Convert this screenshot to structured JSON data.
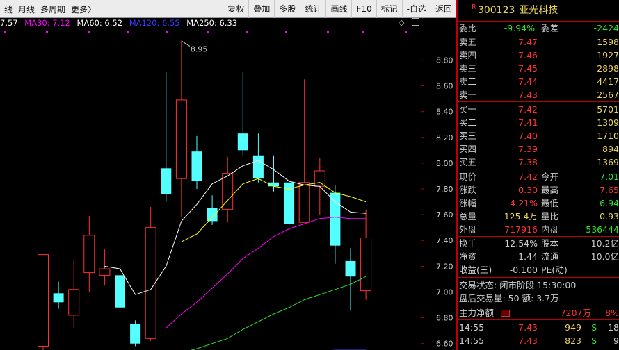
{
  "toolbar": {
    "left_items": [
      "线",
      "月线",
      "多周期",
      "更多〉"
    ],
    "right_buttons": [
      "复权",
      "叠加",
      "多股",
      "统计",
      "画线",
      "F10",
      "标记",
      "-自选",
      "返回"
    ]
  },
  "ma": {
    "ma_first": "7.57",
    "ma30": "MA30: 7.12",
    "ma60": "MA60: 6.52",
    "ma120": "MA120: 6.55",
    "ma250": "MA250: 6.33",
    "color_first": "#ffffff",
    "color_ma30": "#ff00ff",
    "color_ma60": "#2ee32e",
    "color_ma120": "#3a3aff",
    "color_ma250": "#ffffff"
  },
  "chart_data": {
    "type": "candlestick",
    "y_ticks": [
      "8.80",
      "8.60",
      "8.40",
      "8.20",
      "8.00",
      "7.80",
      "7.60",
      "7.40",
      "7.20",
      "7.00",
      "6.80",
      "6.60"
    ],
    "y_range": [
      6.55,
      9.05
    ],
    "peak_label": "8.95",
    "colors": {
      "up": "#ff3232",
      "down": "#54ffff",
      "ma_white": "#ffffff",
      "ma_yellow": "#ffff00",
      "ma_magenta": "#ff00ff",
      "ma_green": "#2ee32e",
      "ma_blue": "#3a3aff"
    },
    "candles": [
      {
        "o": 6.58,
        "h": 7.29,
        "l": 6.55,
        "c": 7.29
      },
      {
        "o": 6.99,
        "h": 7.08,
        "l": 6.87,
        "c": 6.92
      },
      {
        "o": 6.82,
        "h": 7.25,
        "l": 6.72,
        "c": 7.02
      },
      {
        "o": 7.15,
        "h": 7.59,
        "l": 7.0,
        "c": 7.44
      },
      {
        "o": 7.13,
        "h": 7.33,
        "l": 7.05,
        "c": 7.18
      },
      {
        "o": 7.13,
        "h": 7.14,
        "l": 6.78,
        "c": 6.88
      },
      {
        "o": 6.75,
        "h": 6.78,
        "l": 6.58,
        "c": 6.6
      },
      {
        "o": 6.64,
        "h": 7.66,
        "l": 6.62,
        "c": 7.5
      },
      {
        "o": 7.96,
        "h": 8.71,
        "l": 7.7,
        "c": 7.76
      },
      {
        "o": 7.88,
        "h": 8.95,
        "l": 7.58,
        "c": 8.49
      },
      {
        "o": 8.09,
        "h": 8.21,
        "l": 7.8,
        "c": 7.86
      },
      {
        "o": 7.65,
        "h": 7.75,
        "l": 7.52,
        "c": 7.55
      },
      {
        "o": 7.64,
        "h": 8.05,
        "l": 7.54,
        "c": 7.92
      },
      {
        "o": 8.23,
        "h": 8.71,
        "l": 8.06,
        "c": 8.1
      },
      {
        "o": 8.06,
        "h": 8.23,
        "l": 7.85,
        "c": 7.88
      },
      {
        "o": 7.85,
        "h": 8.06,
        "l": 7.78,
        "c": 7.82
      },
      {
        "o": 7.85,
        "h": 7.87,
        "l": 7.5,
        "c": 7.53
      },
      {
        "o": 7.54,
        "h": 8.65,
        "l": 7.54,
        "c": 7.85
      },
      {
        "o": 7.82,
        "h": 8.04,
        "l": 7.6,
        "c": 7.94
      },
      {
        "o": 7.77,
        "h": 7.83,
        "l": 7.22,
        "c": 7.36
      },
      {
        "o": 7.24,
        "h": 7.34,
        "l": 6.86,
        "c": 7.12
      },
      {
        "o": 7.01,
        "h": 7.64,
        "l": 6.94,
        "c": 7.42
      }
    ],
    "ma_lines": [
      {
        "color": "#ffffff",
        "values": [
          null,
          null,
          null,
          null,
          7.2,
          7.18,
          6.98,
          7.02,
          7.2,
          7.55,
          7.68,
          7.84,
          7.9,
          7.98,
          8.02,
          7.95,
          7.86,
          7.83,
          7.82,
          7.7,
          7.62,
          7.61
        ]
      },
      {
        "color": "#ffff00",
        "values": [
          null,
          null,
          null,
          null,
          null,
          null,
          null,
          null,
          null,
          7.39,
          7.45,
          7.58,
          7.71,
          7.84,
          7.88,
          7.82,
          7.8,
          7.83,
          7.85,
          7.77,
          7.74,
          7.7
        ]
      },
      {
        "color": "#ff00ff",
        "values": [
          null,
          null,
          null,
          null,
          null,
          null,
          null,
          null,
          6.72,
          6.83,
          6.92,
          7.03,
          7.14,
          7.26,
          7.34,
          7.43,
          7.49,
          7.53,
          7.57,
          7.58,
          7.57,
          7.57
        ]
      },
      {
        "color": "#2ee32e",
        "values": [
          null,
          null,
          null,
          null,
          null,
          null,
          null,
          null,
          null,
          6.53,
          6.56,
          6.6,
          6.64,
          6.71,
          6.77,
          6.83,
          6.88,
          6.94,
          6.98,
          7.02,
          7.06,
          7.12
        ]
      },
      {
        "color": "#3a3aff",
        "values": [
          null,
          null,
          null,
          null,
          null,
          null,
          null,
          null,
          null,
          6.51,
          6.51,
          6.52,
          6.52,
          6.53,
          6.53,
          6.53,
          6.54,
          6.54,
          6.54,
          6.55,
          6.55,
          6.55
        ]
      },
      {
        "color": "#ffffff",
        "values": [
          null,
          null,
          null,
          null,
          null,
          null,
          null,
          null,
          null,
          null,
          null,
          null,
          null,
          null,
          null,
          null,
          6.45,
          6.47,
          6.49,
          6.51,
          6.52,
          6.54
        ]
      }
    ]
  },
  "quote": {
    "r_badge": "R",
    "code": "300123",
    "name": "亚光科技",
    "weibi_label": "委比",
    "weibi": "-9.94%",
    "weicha_label": "委差",
    "weicha": "-2424",
    "asks": [
      {
        "label": "卖五",
        "price": "7.47",
        "vol": "1598"
      },
      {
        "label": "卖四",
        "price": "7.46",
        "vol": "1927"
      },
      {
        "label": "卖三",
        "price": "7.45",
        "vol": "2898"
      },
      {
        "label": "卖二",
        "price": "7.44",
        "vol": "4417"
      },
      {
        "label": "卖一",
        "price": "7.43",
        "vol": "2567"
      }
    ],
    "bids": [
      {
        "label": "买一",
        "price": "7.42",
        "vol": "5701"
      },
      {
        "label": "买二",
        "price": "7.41",
        "vol": "1309"
      },
      {
        "label": "买三",
        "price": "7.40",
        "vol": "1710"
      },
      {
        "label": "买四",
        "price": "7.39",
        "vol": "894"
      },
      {
        "label": "买五",
        "price": "7.38",
        "vol": "1369"
      }
    ],
    "stats": [
      {
        "l1": "现价",
        "v1": "7.42",
        "c1": "#ff3232",
        "l2": "今开",
        "v2": "7.01",
        "c2": "#2ee32e"
      },
      {
        "l1": "涨跌",
        "v1": "0.30",
        "c1": "#ff3232",
        "l2": "最高",
        "v2": "7.65",
        "c2": "#ff3232"
      },
      {
        "l1": "涨幅",
        "v1": "4.21%",
        "c1": "#ff3232",
        "l2": "最低",
        "v2": "6.94",
        "c2": "#2ee32e"
      },
      {
        "l1": "总量",
        "v1": "125.4万",
        "c1": "#e8d35b",
        "l2": "量比",
        "v2": "0.93",
        "c2": "#e8d35b"
      },
      {
        "l1": "外盘",
        "v1": "717916",
        "c1": "#ff3232",
        "l2": "内盘",
        "v2": "536444",
        "c2": "#2ee32e"
      }
    ],
    "stats2": [
      {
        "l1": "换手",
        "v1": "12.54%",
        "c1": "#cccccc",
        "l2": "股本",
        "v2": "10.2亿",
        "c2": "#cccccc"
      },
      {
        "l1": "净资",
        "v1": "1.44",
        "c1": "#cccccc",
        "l2": "流通",
        "v2": "10.0亿",
        "c2": "#cccccc"
      },
      {
        "l1": "收益(三)",
        "v1": "-0.100",
        "c1": "#cccccc",
        "l2": "PE(动)",
        "v2": "",
        "c2": "#cccccc"
      }
    ],
    "trade_status": "交易状态: 闭市阶段 15:30:00",
    "after_hours": "盘后交易量: 50  额: 3.7万",
    "main_flow_label": "主力净额",
    "main_flow": "7207万",
    "main_flow_pct": "8%",
    "ticks": [
      {
        "time": "14:55",
        "price": "7.43",
        "vol": "949",
        "side": "S",
        "n": "18"
      },
      {
        "time": "14:55",
        "price": "7.43",
        "vol": "823",
        "side": "S",
        "n": "9"
      }
    ]
  }
}
